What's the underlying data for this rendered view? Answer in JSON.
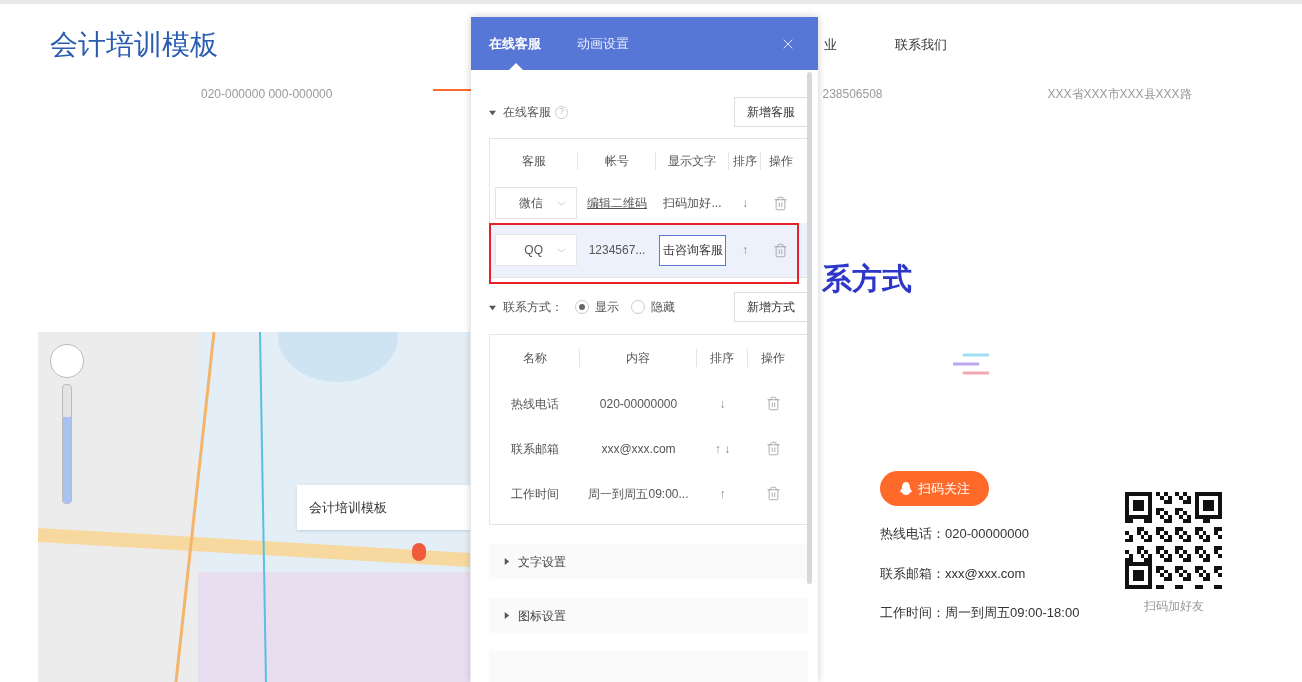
{
  "site": {
    "logo": "会计培训模板",
    "nav": [
      {
        "label": "业"
      },
      {
        "label": "联系我们"
      }
    ],
    "info_row": [
      "020-000000 000-000000",
      "238506508",
      "XXX省XXX市XXX县XXX路"
    ]
  },
  "map": {
    "popup": "会计培训模板",
    "zoom": {
      "level": 0.73
    }
  },
  "contact_section": {
    "title": "系方式",
    "follow_button": "扫码关注",
    "lines": [
      "热线电话：020-00000000",
      "联系邮箱：xxx@xxx.com",
      "工作时间：周一到周五09:00-18:00"
    ],
    "qr_caption": "扫码加好友"
  },
  "panel": {
    "tabs": [
      {
        "label": "在线客服",
        "selected": true
      },
      {
        "label": "动画设置",
        "selected": false
      }
    ],
    "service": {
      "title": "在线客服",
      "help_icon": "?",
      "add_button": "新增客服",
      "columns": [
        "客服",
        "帐号",
        "显示文字",
        "排序",
        "操作"
      ],
      "rows": [
        {
          "service": "微信",
          "account": {
            "kind": "link",
            "text": "编辑二维码"
          },
          "display": {
            "kind": "text",
            "text": "扫码加好..."
          },
          "sort": "↓",
          "highlighted": false
        },
        {
          "service": "QQ",
          "account": {
            "kind": "text",
            "text": "1234567..."
          },
          "display": {
            "kind": "input",
            "text": "击咨询客服"
          },
          "sort": "↑",
          "highlighted": true
        }
      ]
    },
    "contact": {
      "title": "联系方式：",
      "options": [
        {
          "label": "显示",
          "selected": true
        },
        {
          "label": "隐藏",
          "selected": false
        }
      ],
      "add_button": "新增方式",
      "columns": [
        "名称",
        "内容",
        "排序",
        "操作"
      ],
      "rows": [
        {
          "name": "热线电话",
          "content": "020-00000000",
          "sort": "↓"
        },
        {
          "name": "联系邮箱",
          "content": "xxx@xxx.com",
          "sort": "↑ ↓"
        },
        {
          "name": "工作时间",
          "content": "周一到周五09:00...",
          "sort": "↑"
        }
      ]
    },
    "sections": [
      {
        "title": "文字设置",
        "expanded": false
      },
      {
        "title": "图标设置",
        "expanded": false
      }
    ]
  }
}
